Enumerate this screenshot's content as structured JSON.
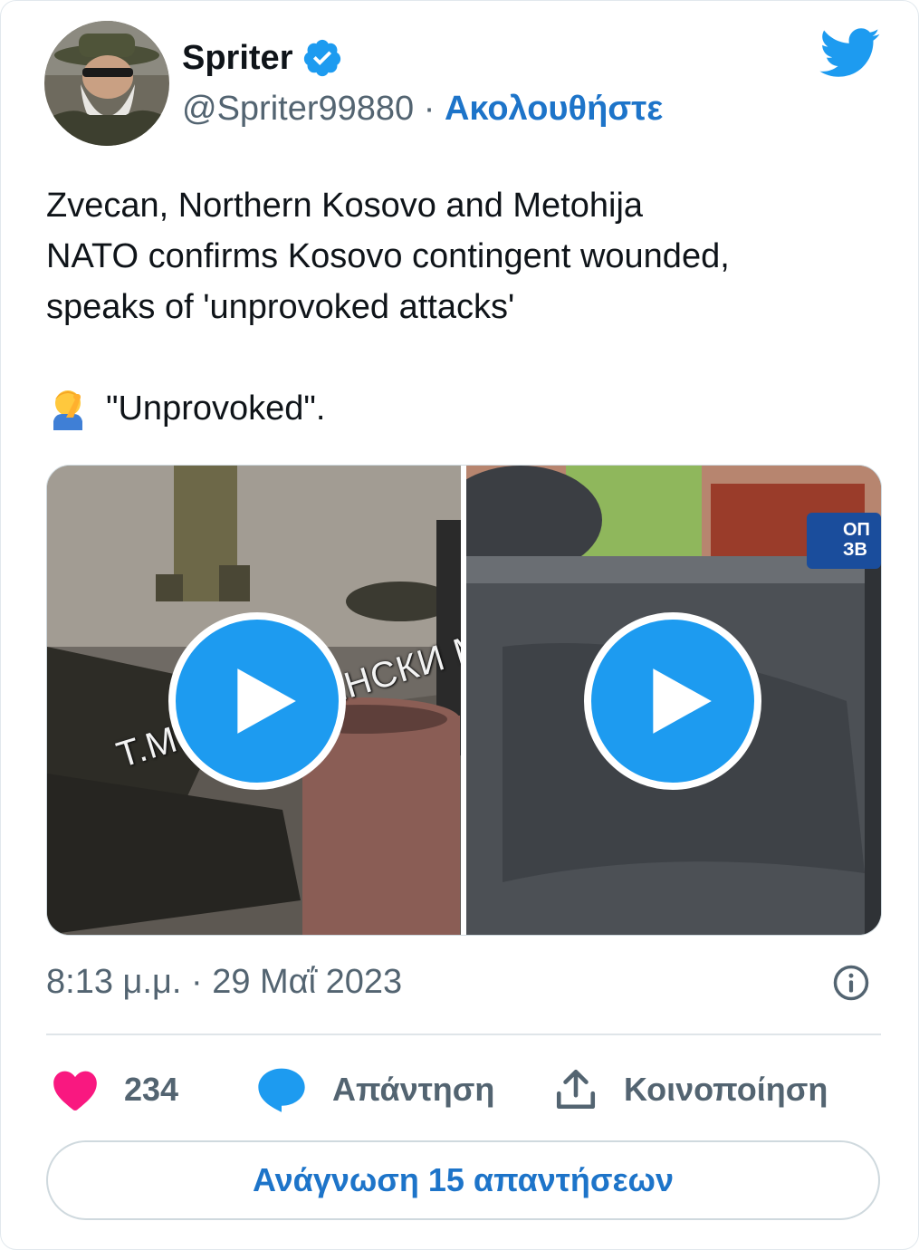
{
  "author": {
    "name": "Spriter",
    "handle": "@Spriter99880",
    "separator": " · ",
    "follow_label": "Ακολουθήστε"
  },
  "tweet": {
    "lines": [
      "Zvecan, Northern Kosovo and Metohija",
      "NATO confirms Kosovo contingent wounded,",
      "speaks of 'unprovoked attacks'"
    ],
    "emoji": "facepalm-emoji",
    "emoji_text": "\"Unprovoked\"."
  },
  "media": {
    "left_video": {
      "watermark": "T.ME/ СЛОВЕНСКИ М"
    },
    "right_video": {
      "sign_text": "ОПШ\nЗВ"
    }
  },
  "meta": {
    "timestamp": "8:13 μ.μ. · 29 Μαΐ 2023"
  },
  "actions": {
    "likes": "234",
    "reply_label": "Απάντηση",
    "share_label": "Κοινοποίηση"
  },
  "read_replies_label": "Ανάγνωση 15 απαντήσεων",
  "colors": {
    "accent": "#1d9bf0",
    "link": "#1d74c9",
    "heart": "#f91880",
    "muted": "#536471"
  },
  "icons": [
    "verified-badge-icon",
    "twitter-bird-icon",
    "play-icon",
    "info-icon",
    "heart-icon",
    "reply-bubble-icon",
    "share-icon"
  ]
}
